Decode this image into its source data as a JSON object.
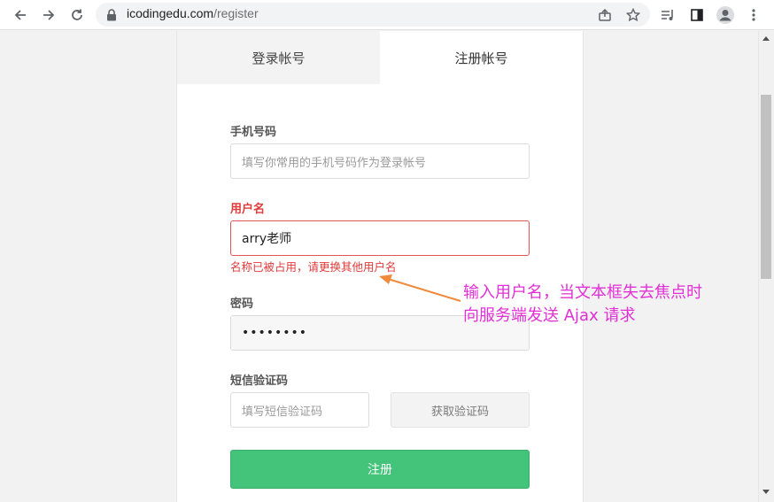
{
  "browser": {
    "url_host": "icodingedu.com",
    "url_path": "/register"
  },
  "tabs": {
    "login": "登录帐号",
    "register": "注册帐号"
  },
  "form": {
    "phone_label": "手机号码",
    "phone_placeholder": "填写你常用的手机号码作为登录帐号",
    "username_label": "用户名",
    "username_value": "arry老师",
    "username_error": "名称已被占用，请更换其他用户名",
    "password_label": "密码",
    "password_value": "••••••••",
    "sms_label": "短信验证码",
    "sms_placeholder": "填写短信验证码",
    "sms_button": "获取验证码",
    "submit_label": "注册"
  },
  "annotation": {
    "line1": "输入用户名，当文本框失去焦点时",
    "line2": "向服务端发送 Ajax 请求",
    "color": "#e22fd6",
    "arrow_color": "#f08a3c"
  },
  "colors": {
    "error": "#e03a3a",
    "submit": "#44c47a"
  }
}
